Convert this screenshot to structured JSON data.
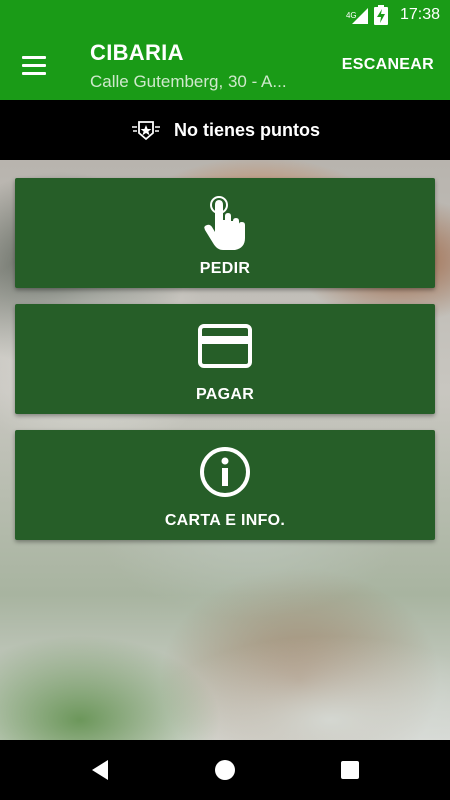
{
  "status_bar": {
    "network": "4G",
    "time": "17:38",
    "icons": [
      "signal-icon",
      "battery-charging-icon"
    ]
  },
  "app_bar": {
    "menu_icon": "menu-icon",
    "title": "CIBARIA",
    "subtitle": "Calle Gutemberg, 30 - A...",
    "scan_label": "ESCANEAR"
  },
  "points": {
    "icon": "badge-star-icon",
    "text": "No tienes puntos"
  },
  "actions": [
    {
      "label": "PEDIR",
      "icon": "touch-hand-icon"
    },
    {
      "label": "PAGAR",
      "icon": "credit-card-icon"
    },
    {
      "label": "CARTA E INFO.",
      "icon": "info-icon"
    }
  ],
  "colors": {
    "app_bar": "#1a9b17",
    "card": "#265e28",
    "points_bar": "#000000"
  },
  "nav_bar": {
    "icons": [
      "back-icon",
      "home-icon",
      "recents-icon"
    ]
  }
}
